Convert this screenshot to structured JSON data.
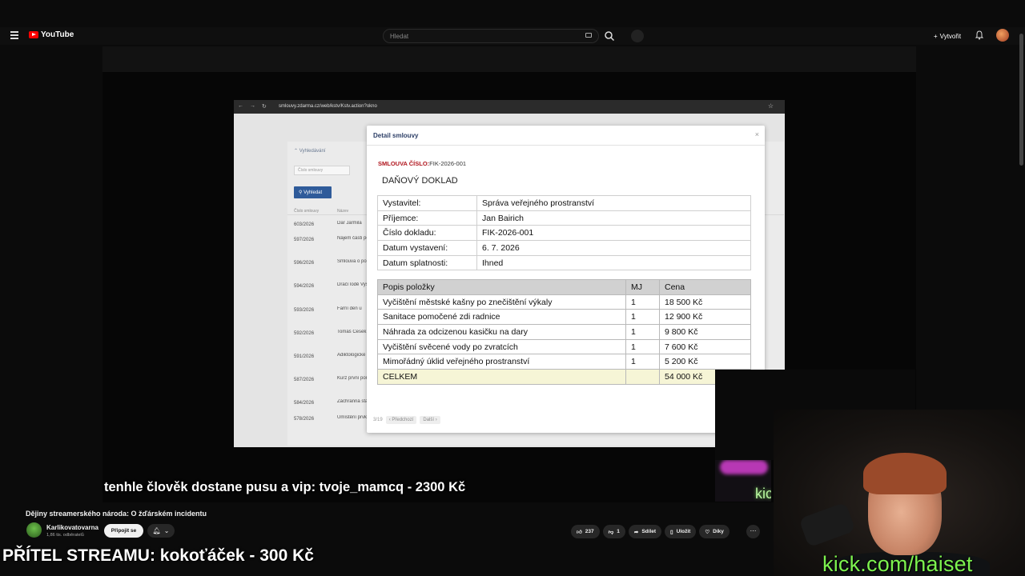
{
  "youtube": {
    "logo_text": "YouTube",
    "search_placeholder": "Hledat",
    "create_label": "Vytvořit",
    "video_title": "Dějiny streamerského národa: O žďárském incidentu",
    "channel_name": "Karlikovatovarna",
    "channel_subs": "1,86 tis. odběratelů",
    "join_label": "Připojit se",
    "like_count": "237",
    "dislike_count": "1",
    "share_label": "Sdílet",
    "save_label": "Uložit",
    "thanks_label": "Díky"
  },
  "browser": {
    "url": "smlouvy.zdarma.cz/web/kstv/Kstv.action?okno"
  },
  "background_list": {
    "filter_label": "Vyhledávání",
    "input_placeholder": "Číslo smlouvy",
    "search_button": "Vyhledat",
    "col_number": "Číslo smlouvy",
    "col_name": "Název",
    "rows": [
      {
        "id": "603/2026",
        "name": "Dar Jarmila"
      },
      {
        "id": "597/2026",
        "name": "Nájem části pozemku"
      },
      {
        "id": "596/2026",
        "name": "Smlouva o poskytnutí"
      },
      {
        "id": "594/2026",
        "name": "Dračí lodě Vysočina"
      },
      {
        "id": "593/2026",
        "name": "Farní den u"
      },
      {
        "id": "592/2026",
        "name": "Tomáš Česek"
      },
      {
        "id": "591/2026",
        "name": "Adiktologické"
      },
      {
        "id": "587/2026",
        "name": "Kurz první pomoci"
      },
      {
        "id": "584/2026",
        "name": "Záchranná stanice"
      },
      {
        "id": "578/2026",
        "name": "Umístění prvku"
      }
    ]
  },
  "modal": {
    "title": "Detail smlouvy",
    "close": "×",
    "contract_label": "SMLOUVA ČÍSLO:",
    "contract_number": "FIK-2026-001",
    "doc_title": "DAŇOVÝ DOKLAD",
    "info": [
      {
        "label": "Vystavitel:",
        "value": "Správa veřejného prostranství"
      },
      {
        "label": "Příjemce:",
        "value": "Jan Bairich"
      },
      {
        "label": "Číslo dokladu:",
        "value": "FIK-2026-001"
      },
      {
        "label": "Datum vystavení:",
        "value": "6. 7. 2026"
      },
      {
        "label": "Datum splatnosti:",
        "value": "Ihned"
      }
    ],
    "items_header": {
      "desc": "Popis položky",
      "unit": "MJ",
      "price": "Cena"
    },
    "items": [
      {
        "desc": "Vyčištění městské kašny po znečištění výkaly",
        "unit": "1",
        "price": "18 500 Kč"
      },
      {
        "desc": "Sanitace pomočené zdi radnice",
        "unit": "1",
        "price": "12 900 Kč"
      },
      {
        "desc": "Náhrada za odcizenou kasičku na dary",
        "unit": "1",
        "price": "9 800 Kč"
      },
      {
        "desc": "Vyčištění svěcené vody po zvratcích",
        "unit": "1",
        "price": "7 600 Kč"
      },
      {
        "desc": "Mimořádný úklid veřejného prostranství",
        "unit": "1",
        "price": "5 200 Kč"
      }
    ],
    "total_label": "CELKEM",
    "total_price": "54 000 Kč",
    "pager_count": "3/19",
    "prev_label": "‹ Předchozí",
    "next_label": "Další ›"
  },
  "overlay": {
    "donation_text": "tenhle člověk dostane pusu a vip: tvoje_mamcq - 2300 Kč",
    "friend_text": "PŘÍTEL STREAMU: kokoťáček - 300 Kč",
    "kick_url": "kick.com/haiset",
    "neon_text": "kic"
  }
}
